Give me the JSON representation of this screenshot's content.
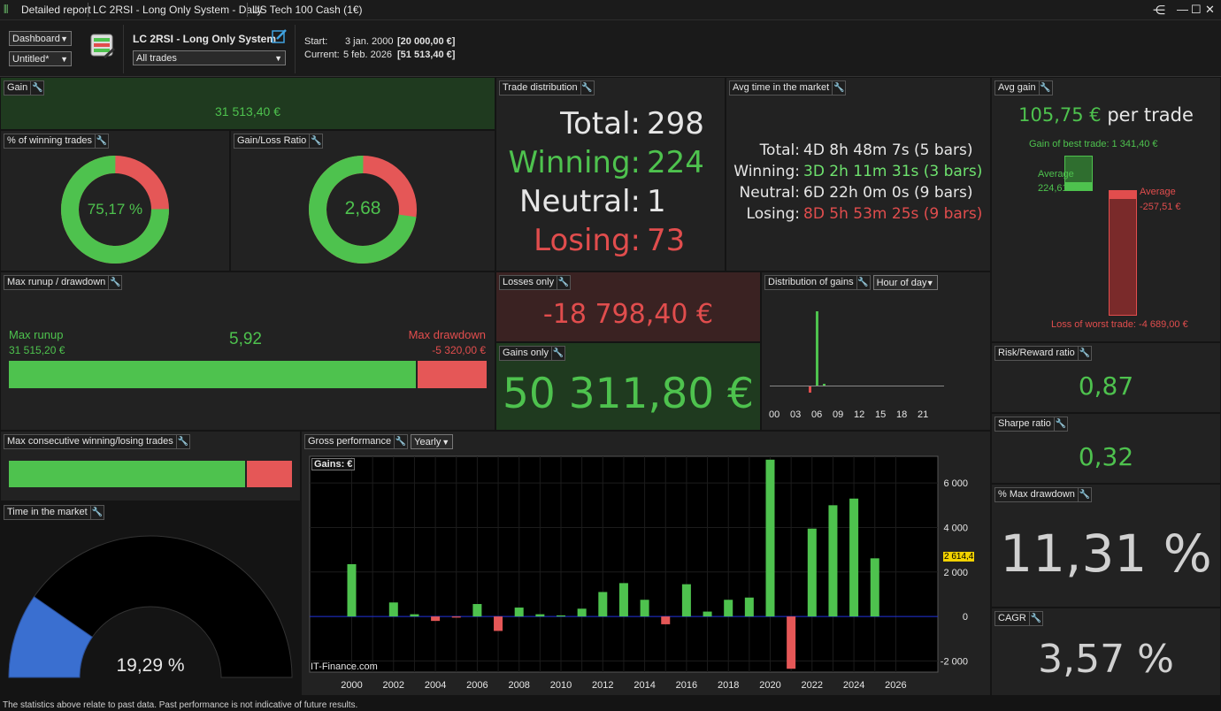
{
  "titlebar": {
    "report": "Detailed report",
    "system": "LC 2RSI - Long Only System - Daily",
    "instrument": "US Tech 100 Cash (1€)"
  },
  "header": {
    "view_select": "Dashboard",
    "layout_select": "Untitled*",
    "system_name": "LC 2RSI - Long Only System",
    "trades_select": "All trades",
    "start_label": "Start:",
    "start_date": "3 jan. 2000",
    "start_capital": "[20 000,00 €]",
    "current_label": "Current:",
    "current_date": "5 feb. 2026",
    "current_capital": "[51 513,40 €]"
  },
  "gain": {
    "title": "Gain",
    "value": "31 513,40 €"
  },
  "winning_pct": {
    "title": "% of winning trades",
    "value": "75,17 %",
    "fraction": 0.7517
  },
  "gain_loss_ratio": {
    "title": "Gain/Loss Ratio",
    "value": "2,68",
    "fraction": 0.728
  },
  "trade_distribution": {
    "title": "Trade distribution",
    "rows": [
      {
        "label": "Total:",
        "value": "298"
      },
      {
        "label": "Winning:",
        "value": "224"
      },
      {
        "label": "Neutral:",
        "value": "1"
      },
      {
        "label": "Losing:",
        "value": "73"
      }
    ]
  },
  "avg_time": {
    "title": "Avg time in the market",
    "rows": [
      {
        "label": "Total:",
        "value": "4D 8h 48m 7s (5 bars)"
      },
      {
        "label": "Winning:",
        "value": "3D 2h 11m 31s (3 bars)"
      },
      {
        "label": "Neutral:",
        "value": "6D 22h 0m 0s (9 bars)"
      },
      {
        "label": "Losing:",
        "value": "8D 5h 53m 25s (9 bars)"
      }
    ]
  },
  "avg_gain": {
    "title": "Avg gain",
    "value": "105,75 €",
    "suffix": "per trade",
    "best_trade": "Gain of best trade: 1 341,40 €",
    "avg_win_label": "Average",
    "avg_win_value": "224,61 €",
    "avg_loss_label": "Average",
    "avg_loss_value": "-257,51 €",
    "worst_trade": "Loss of worst trade: -4 689,00 €"
  },
  "runup": {
    "title": "Max runup / drawdown",
    "runup_label": "Max runup",
    "runup_value": "31 515,20 €",
    "ratio": "5,92",
    "drawdown_label": "Max drawdown",
    "drawdown_value": "-5 320,00 €",
    "runup_fraction": 0.855
  },
  "losses_only": {
    "title": "Losses only",
    "value": "-18 798,40 €"
  },
  "gains_only": {
    "title": "Gains only",
    "value": "50 311,80 €"
  },
  "distribution_of_gains": {
    "title": "Distribution of gains",
    "mode": "Hour of day",
    "ticks": [
      "00",
      "03",
      "06",
      "09",
      "12",
      "15",
      "18",
      "21"
    ]
  },
  "risk_reward": {
    "title": "Risk/Reward ratio",
    "value": "0,87"
  },
  "sharpe": {
    "title": "Sharpe ratio",
    "value": "0,32"
  },
  "max_drawdown_pct": {
    "title": "% Max drawdown",
    "value": "11,31 %"
  },
  "cagr": {
    "title": "CAGR",
    "value": "3,57 %"
  },
  "consecutive": {
    "title": "Max consecutive winning/losing trades",
    "win_fraction": 0.84
  },
  "time_in_market": {
    "title": "Time in the market",
    "value": "19,29 %",
    "fraction": 0.1929
  },
  "gross_performance": {
    "title": "Gross performance",
    "period": "Yearly",
    "legend": "Gains: €",
    "watermark": "IT-Finance.com",
    "last_value_label": "2 614,4"
  },
  "colors": {
    "green": "#4ec24e",
    "red": "#e14d4d",
    "blue": "#3a6fd0",
    "panel": "#222222"
  },
  "chart_data": {
    "type": "bar",
    "ylabel": "Gains: €",
    "ylim": [
      -2500,
      7200
    ],
    "yticks": [
      -2000,
      0,
      2000,
      4000,
      6000
    ],
    "ytick_labels": [
      "-2 000",
      "0",
      "2 000",
      "4 000",
      "6 000"
    ],
    "xtick_labels": [
      "2000",
      "2002",
      "2004",
      "2006",
      "2008",
      "2010",
      "2012",
      "2014",
      "2016",
      "2018",
      "2020",
      "2022",
      "2024",
      "2026"
    ],
    "categories": [
      2000,
      2001,
      2002,
      2003,
      2004,
      2005,
      2006,
      2007,
      2008,
      2009,
      2010,
      2011,
      2012,
      2013,
      2014,
      2015,
      2016,
      2017,
      2018,
      2019,
      2020,
      2021,
      2022,
      2023,
      2024,
      2025,
      2026
    ],
    "values": [
      2350,
      0,
      630,
      100,
      -200,
      -50,
      560,
      -650,
      400,
      100,
      50,
      350,
      1100,
      1500,
      750,
      -350,
      1450,
      220,
      750,
      850,
      7050,
      -2350,
      3950,
      5000,
      5300,
      2614.4,
      0
    ]
  },
  "footer": "The statistics above relate to past data. Past performance is not indicative of future results."
}
